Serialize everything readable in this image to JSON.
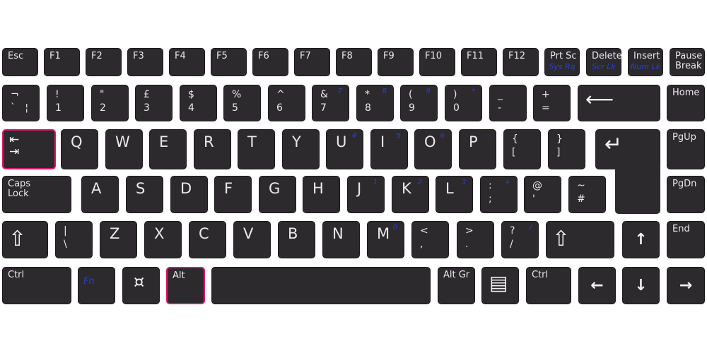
{
  "colors": {
    "key": "#2d2a2e",
    "label": "#e9e9e9",
    "secondary": "#2b3fcc",
    "highlight": "#e0166a"
  },
  "highlighted_keys": [
    "Tab",
    "Alt"
  ],
  "rows": [
    [
      {
        "top": "Esc"
      },
      {
        "top": "F1"
      },
      {
        "top": "F2"
      },
      {
        "top": "F3"
      },
      {
        "top": "F4"
      },
      {
        "top": "F5"
      },
      {
        "top": "F6"
      },
      {
        "top": "F7"
      },
      {
        "top": "F8"
      },
      {
        "top": "F9"
      },
      {
        "top": "F10"
      },
      {
        "top": "F11"
      },
      {
        "top": "F12"
      },
      {
        "top": "Prt Sc",
        "blue": "Sys Rq"
      },
      {
        "top": "Delete",
        "blue": "Scr Lk"
      },
      {
        "top": "Insert",
        "blue": "Num Lk"
      },
      {
        "top": "Pause\nBreak"
      }
    ],
    [
      {
        "top": "¬",
        "bottom": "`   ¦"
      },
      {
        "top": "!",
        "bottom": "1"
      },
      {
        "top": "\"",
        "bottom": "2"
      },
      {
        "top": "£",
        "bottom": "3"
      },
      {
        "top": "$",
        "bottom": "4"
      },
      {
        "top": "%",
        "bottom": "5"
      },
      {
        "top": "^",
        "bottom": "6"
      },
      {
        "top": "&",
        "bottom": "7",
        "blue": "7"
      },
      {
        "top": "*",
        "bottom": "8",
        "blue": "8"
      },
      {
        "top": "(",
        "bottom": "9",
        "blue": "9"
      },
      {
        "top": ")",
        "bottom": "0",
        "blue": "*"
      },
      {
        "top": "_",
        "bottom": "-"
      },
      {
        "top": "+",
        "bottom": "="
      },
      {
        "icon": "backspace-arrow-icon",
        "glyph": "⟵"
      },
      {
        "top": "Home"
      }
    ],
    [
      {
        "icon": "tab-arrows-icon",
        "glyph": "⇤\n⇥",
        "name": "Tab"
      },
      {
        "letter": "Q"
      },
      {
        "letter": "W"
      },
      {
        "letter": "E"
      },
      {
        "letter": "R"
      },
      {
        "letter": "T"
      },
      {
        "letter": "Y"
      },
      {
        "letter": "U",
        "blue": "4"
      },
      {
        "letter": "I",
        "blue": "5"
      },
      {
        "letter": "O",
        "blue": "6"
      },
      {
        "letter": "P",
        "blue": "-"
      },
      {
        "top": "{",
        "bottom": "["
      },
      {
        "top": "}",
        "bottom": "]"
      },
      {
        "icon": "enter-arrow-icon",
        "glyph": "↵"
      },
      {
        "top": "PgUp"
      }
    ],
    [
      {
        "top": "Caps\nLock"
      },
      {
        "letter": "A"
      },
      {
        "letter": "S"
      },
      {
        "letter": "D"
      },
      {
        "letter": "F"
      },
      {
        "letter": "G"
      },
      {
        "letter": "H"
      },
      {
        "letter": "J",
        "blue": "1"
      },
      {
        "letter": "K",
        "blue": "2"
      },
      {
        "letter": "L",
        "blue": "3"
      },
      {
        "top": ":",
        "bottom": ";",
        "blue": "+"
      },
      {
        "top": "@",
        "bottom": "'"
      },
      {
        "top": "~",
        "bottom": "#"
      },
      {
        "top": "PgDn"
      }
    ],
    [
      {
        "icon": "shift-icon",
        "glyph": "⇧"
      },
      {
        "top": "|",
        "bottom": "\\"
      },
      {
        "letter": "Z"
      },
      {
        "letter": "X"
      },
      {
        "letter": "C"
      },
      {
        "letter": "V"
      },
      {
        "letter": "B"
      },
      {
        "letter": "N"
      },
      {
        "letter": "M",
        "blue": "0"
      },
      {
        "top": "<",
        "bottom": ","
      },
      {
        "top": ">",
        "bottom": "."
      },
      {
        "top": "?",
        "bottom": "/",
        "blue": "/"
      },
      {
        "icon": "shift-icon",
        "glyph": "⇧"
      },
      {
        "icon": "arrow-up-icon",
        "glyph": "↑"
      },
      {
        "top": "End"
      }
    ],
    [
      {
        "top": "Ctrl"
      },
      {
        "blue": "Fn"
      },
      {
        "icon": "windows-key-icon",
        "glyph": "¤"
      },
      {
        "top": "Alt",
        "name": "Alt"
      },
      {
        "name": "Space"
      },
      {
        "top": "Alt Gr"
      },
      {
        "icon": "menu-key-icon",
        "glyph": "▤"
      },
      {
        "top": "Ctrl"
      },
      {
        "icon": "arrow-left-icon",
        "glyph": "←"
      },
      {
        "icon": "arrow-down-icon",
        "glyph": "↓"
      },
      {
        "icon": "arrow-right-icon",
        "glyph": "→"
      }
    ]
  ]
}
